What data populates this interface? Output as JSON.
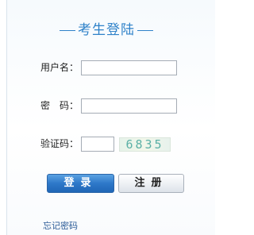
{
  "form": {
    "title": "考生登陆",
    "username_label": "用户名：",
    "username_value": "",
    "password_label": "密　码：",
    "password_value": "",
    "captcha_label": "验证码：",
    "captcha_value": "",
    "captcha_text": "6835",
    "login_button": "登录",
    "register_button": "注册",
    "forgot_link": "忘记密码"
  },
  "colors": {
    "title": "#2f82c9",
    "login_button": "#2e78c9",
    "link": "#2a5a96"
  }
}
